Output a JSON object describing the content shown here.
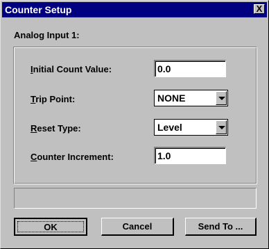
{
  "window": {
    "title": "Counter Setup",
    "close_label": "X"
  },
  "section_label": "Analog Input 1:",
  "fields": {
    "initial_count": {
      "label_ul": "I",
      "label_rest": "nitial Count Value:",
      "value": "0.0"
    },
    "trip_point": {
      "label_ul": "T",
      "label_rest": "rip Point:",
      "value": "NONE"
    },
    "reset_type": {
      "label_ul": "R",
      "label_rest": "eset Type:",
      "value": "Level"
    },
    "counter_increment": {
      "label_ul": "C",
      "label_rest": "ounter Increment:",
      "value": "1.0"
    }
  },
  "status_text": "",
  "buttons": {
    "ok": "OK",
    "cancel": "Cancel",
    "send_to": "Send To ..."
  }
}
